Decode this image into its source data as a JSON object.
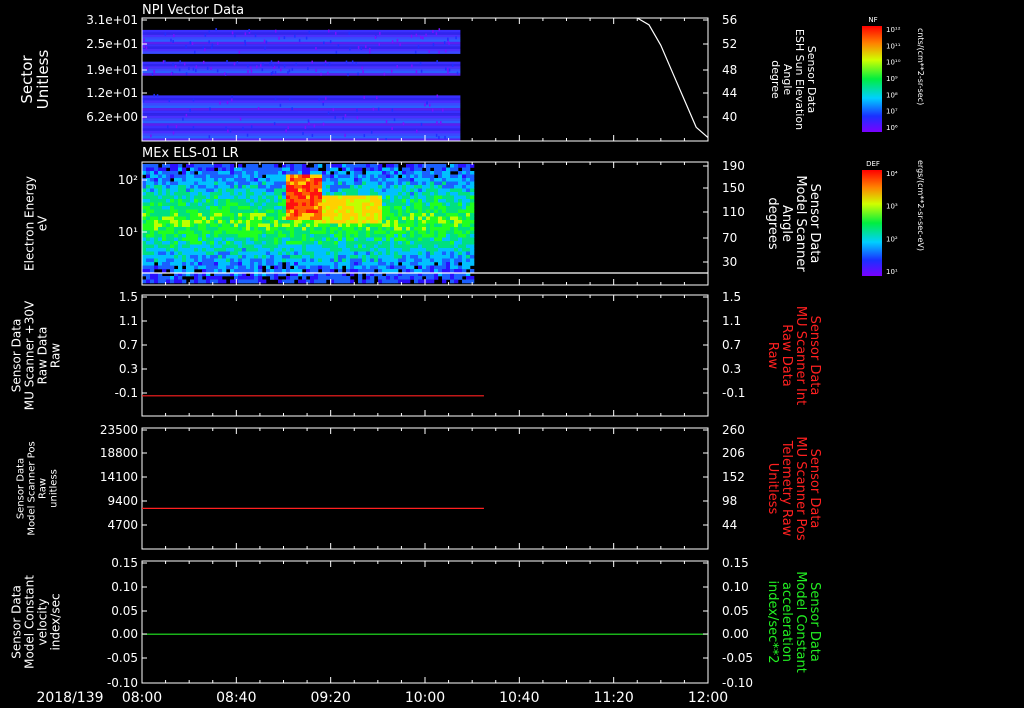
{
  "x_axis": {
    "date_label": "2018/139",
    "ticks": [
      "08:00",
      "08:40",
      "09:20",
      "10:00",
      "10:40",
      "11:20",
      "12:00"
    ]
  },
  "colors": {
    "axis": "#ffffff",
    "red_trace": "#ff2020",
    "green_trace": "#22ee22"
  },
  "colorbars": [
    {
      "tag": "NF",
      "unit_label": "cnts/(cm**2-sr-sec)",
      "tick_labels": [
        "10¹²",
        "10¹¹",
        "10¹⁰",
        "10⁹",
        "10⁸",
        "10⁷",
        "10⁶"
      ]
    },
    {
      "tag": "DEF",
      "unit_label": "ergs/(cm**2-sr-sec-eV)",
      "tick_labels": [
        "10⁴",
        "10³",
        "10²",
        "10¹"
      ]
    }
  ],
  "panels": [
    {
      "title": "NPI Vector Data",
      "left_label": [
        "Sector",
        "Unitless"
      ],
      "left_ticks": [
        "3.1e+01",
        "2.5e+01",
        "1.9e+01",
        "1.2e+01",
        "6.2e+00"
      ],
      "right_label": [
        "Sensor Data",
        "ESH Sun Elevation",
        "Angle",
        "degree"
      ],
      "right_ticks": [
        "56",
        "52",
        "48",
        "44",
        "40"
      ]
    },
    {
      "title": "MEx ELS-01 LR",
      "left_label": [
        "Electron Energy",
        "eV"
      ],
      "left_ticks": [
        "10²",
        "10¹"
      ],
      "right_label": [
        "Sensor Data",
        "Model Scanner",
        "Angle",
        "degrees"
      ],
      "right_ticks": [
        "190",
        "150",
        "110",
        "70",
        "30"
      ]
    },
    {
      "title": "",
      "left_label": [
        "Sensor Data",
        "MU Scanner +30V",
        "Raw Data",
        "Raw"
      ],
      "left_ticks": [
        "1.5",
        "1.1",
        "0.7",
        "0.3",
        "-0.1"
      ],
      "right_label": [
        "Sensor Data",
        "MU Scanner Int",
        "Raw Data",
        "Raw"
      ],
      "right_ticks": [
        "1.5",
        "1.1",
        "0.7",
        "0.3",
        "-0.1"
      ]
    },
    {
      "title": "",
      "left_label": [
        "Sensor Data",
        "Model Scanner Pos",
        "Raw",
        "unitless"
      ],
      "left_ticks": [
        "23500",
        "18800",
        "14100",
        "9400",
        "4700"
      ],
      "right_label": [
        "Sensor Data",
        "MU Scanner Pos",
        "Telemetry Raw",
        "Unitless"
      ],
      "right_ticks": [
        "260",
        "206",
        "152",
        "98",
        "44"
      ]
    },
    {
      "title": "",
      "left_label": [
        "Sensor Data",
        "Model Constant",
        "velocity",
        "index/sec"
      ],
      "left_ticks": [
        "0.15",
        "0.10",
        "0.05",
        "0.00",
        "-0.05",
        "-0.10"
      ],
      "right_label": [
        "Sensor Data",
        "Model Constant",
        "acceleration",
        "index/sec**2"
      ],
      "right_ticks": [
        "0.15",
        "0.10",
        "0.05",
        "0.00",
        "-0.05",
        "-0.10"
      ]
    }
  ],
  "chart_data": [
    {
      "type": "heatmap",
      "title": "NPI Vector Data",
      "x_range": [
        "08:00",
        "12:00"
      ],
      "data_x_range": [
        "08:00",
        "10:15"
      ],
      "y_label": "Sector Unitless",
      "y_range": [
        0,
        31
      ],
      "y_ticks": [
        31,
        25,
        19,
        12,
        6.2
      ],
      "sector_bands": [
        [
          0,
          11.5
        ],
        [
          16.5,
          20
        ],
        [
          22,
          28
        ]
      ],
      "colorbar": "NF",
      "overlay_line": {
        "label": "Sensor Data ESH Sun Elevation Angle",
        "unit": "degree",
        "y_range": [
          38,
          56
        ],
        "color": "#ffffff",
        "points": [
          [
            "11:30",
            56
          ],
          [
            "11:35",
            55
          ],
          [
            "11:40",
            52
          ],
          [
            "11:45",
            48
          ],
          [
            "11:50",
            44
          ],
          [
            "11:55",
            40
          ],
          [
            "12:00",
            38.5
          ]
        ]
      }
    },
    {
      "type": "heatmap",
      "title": "MEx ELS-01 LR",
      "x_range": [
        "08:00",
        "12:00"
      ],
      "data_x_range": [
        "08:00",
        "10:20"
      ],
      "y_label": "Electron Energy",
      "y_unit": "eV",
      "y_scale": "log",
      "y_range": [
        1,
        200
      ],
      "colorbar": "DEF",
      "enhancement": {
        "start": "09:00",
        "end": "09:15",
        "energy_range": [
          12,
          100
        ]
      },
      "overlay_line": {
        "label": "Sensor Data Model Scanner Angle",
        "unit": "degrees",
        "y_range": [
          10,
          190
        ],
        "value": 12,
        "color": "#ffffff"
      }
    },
    {
      "type": "line",
      "x_range": [
        "08:00",
        "12:00"
      ],
      "y_range": [
        -0.3,
        1.5
      ],
      "series": [
        {
          "x": [
            "08:00",
            "10:25"
          ],
          "y": [
            0,
            0
          ],
          "color": "#ff2020"
        }
      ]
    },
    {
      "type": "line",
      "x_range": [
        "08:00",
        "12:00"
      ],
      "y_range": [
        0,
        25000
      ],
      "series": [
        {
          "x": [
            "08:00",
            "10:25"
          ],
          "y": [
            8400,
            8400
          ],
          "color": "#ff2020"
        }
      ]
    },
    {
      "type": "line",
      "x_range": [
        "08:00",
        "12:00"
      ],
      "y_range": [
        -0.1,
        0.15
      ],
      "series": [
        {
          "x": [
            "08:00",
            "12:00"
          ],
          "y": [
            0,
            0
          ],
          "color": "#22ee22"
        }
      ]
    }
  ]
}
